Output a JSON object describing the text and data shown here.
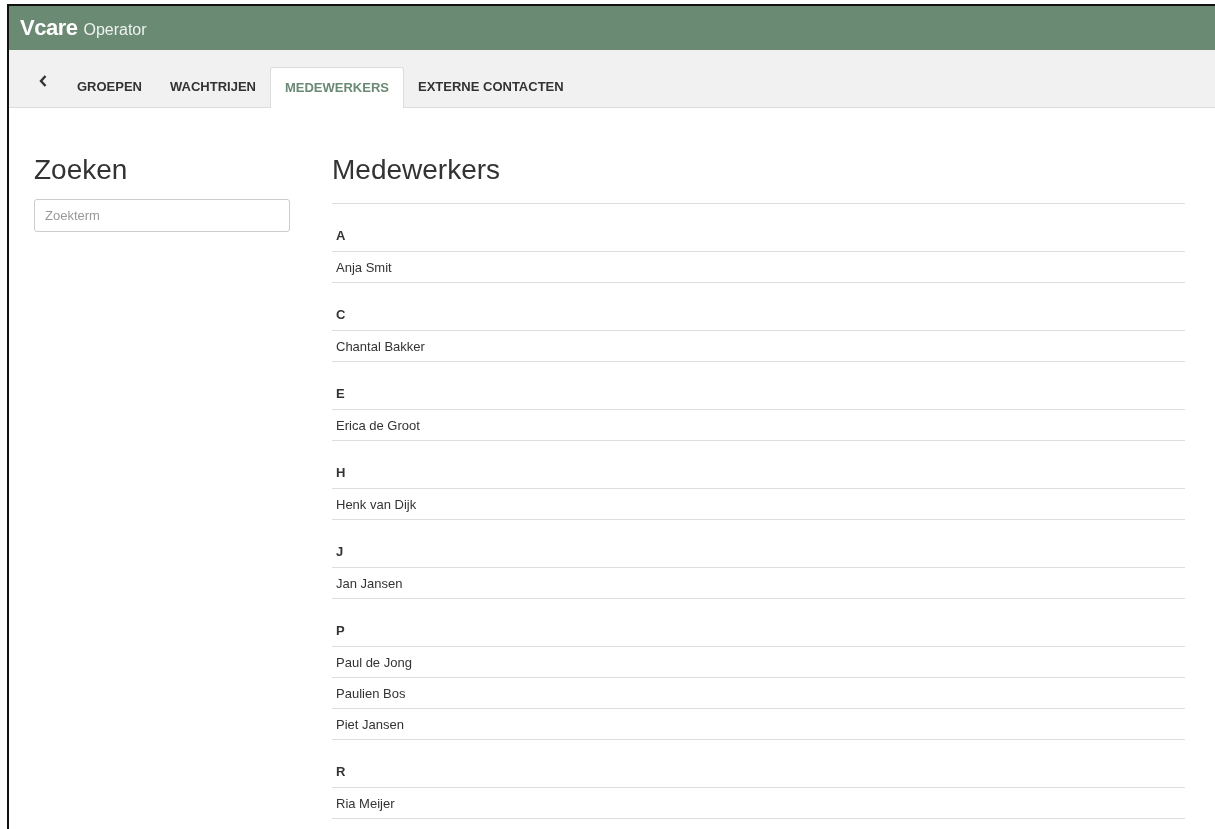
{
  "header": {
    "logo": "Vcare",
    "product": "Operator"
  },
  "tabs": [
    {
      "label": "GROEPEN",
      "selected": false
    },
    {
      "label": "WACHTRIJEN",
      "selected": false
    },
    {
      "label": "MEDEWERKERS",
      "selected": true
    },
    {
      "label": "EXTERNE CONTACTEN",
      "selected": false
    }
  ],
  "search": {
    "title": "Zoeken",
    "placeholder": "Zoekterm"
  },
  "list": {
    "title": "Medewerkers",
    "groups": [
      {
        "letter": "A",
        "names": [
          "Anja Smit"
        ]
      },
      {
        "letter": "C",
        "names": [
          "Chantal Bakker"
        ]
      },
      {
        "letter": "E",
        "names": [
          "Erica de Groot"
        ]
      },
      {
        "letter": "H",
        "names": [
          "Henk van Dijk"
        ]
      },
      {
        "letter": "J",
        "names": [
          "Jan Jansen"
        ]
      },
      {
        "letter": "P",
        "names": [
          "Paul de Jong",
          "Paulien Bos",
          "Piet Jansen"
        ]
      },
      {
        "letter": "R",
        "names": [
          "Ria Meijer"
        ]
      }
    ]
  }
}
